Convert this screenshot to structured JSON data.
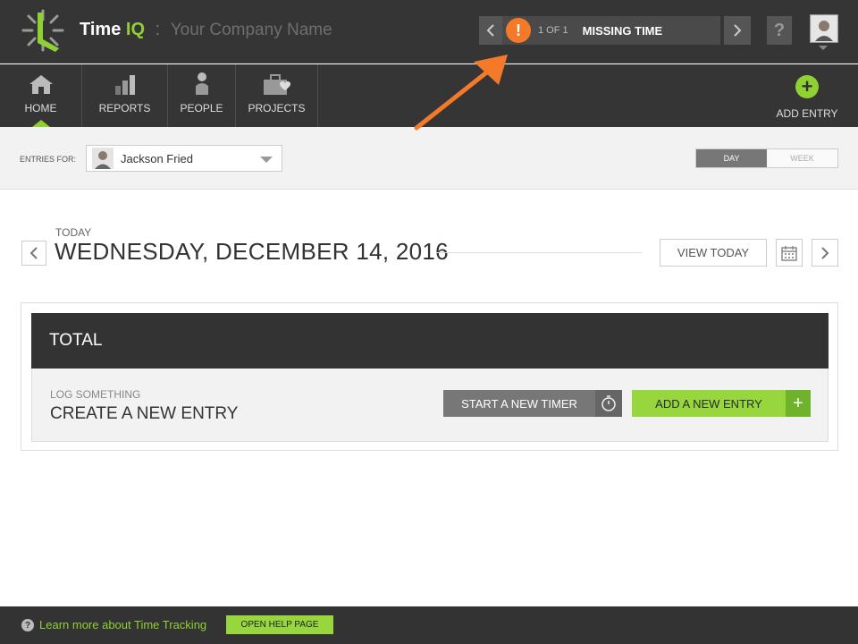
{
  "header": {
    "brand_name": "Time",
    "brand_suffix": "IQ",
    "separator": ":",
    "company": "Your Company Name",
    "alert": {
      "symbol": "!",
      "count": "1 OF 1",
      "label": "MISSING TIME"
    },
    "help_symbol": "?"
  },
  "nav": {
    "items": [
      {
        "label": "HOME",
        "icon": "home-icon"
      },
      {
        "label": "REPORTS",
        "icon": "bar-chart-icon"
      },
      {
        "label": "PEOPLE",
        "icon": "person-icon"
      },
      {
        "label": "PROJECTS",
        "icon": "briefcase-heart-icon"
      }
    ],
    "add_entry": "ADD ENTRY"
  },
  "filter": {
    "entries_for": "ENTRIES FOR:",
    "user": "Jackson Fried",
    "toggle": {
      "day": "DAY",
      "week": "WEEK"
    }
  },
  "date": {
    "today_label": "TODAY",
    "title": "WEDNESDAY, DECEMBER 14, 2016",
    "view_today": "VIEW TODAY"
  },
  "card": {
    "header": "TOTAL",
    "log_label": "LOG SOMETHING",
    "create_label": "CREATE A NEW ENTRY",
    "timer_button": "START A NEW TIMER",
    "new_entry_button": "ADD A NEW ENTRY"
  },
  "footer": {
    "learn": "Learn more about Time Tracking",
    "help_button": "OPEN HELP PAGE"
  },
  "colors": {
    "accent_green": "#97d63c",
    "alert_orange": "#f47a2a",
    "dark": "#353535"
  }
}
